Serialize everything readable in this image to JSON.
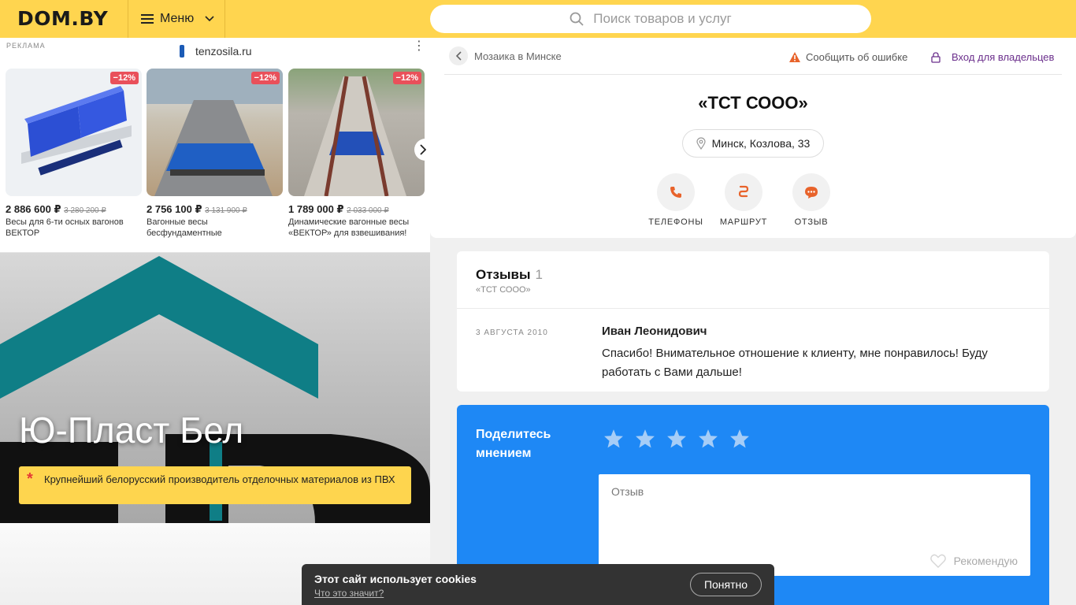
{
  "header": {
    "logo": "DOM.BY",
    "menu_label": "Меню",
    "search_placeholder": "Поиск товаров и услуг"
  },
  "ad": {
    "label": "РЕКЛАМА",
    "domain": "tenzosila.ru",
    "cards": [
      {
        "discount": "−12%",
        "price": "2 886 600 ₽",
        "old_price": "3 280 200 ₽",
        "title": "Весы для 6-ти осных вагонов ВЕКТОР"
      },
      {
        "discount": "−12%",
        "price": "2 756 100 ₽",
        "old_price": "3 131 900 ₽",
        "title": "Вагонные весы бесфундаментные"
      },
      {
        "discount": "−12%",
        "price": "1 789 000 ₽",
        "old_price": "2 033 000 ₽",
        "title": "Динамические вагонные весы «ВЕКТОР» для взвешивания!"
      }
    ]
  },
  "banner": {
    "title": "Ю-Пласт Бел",
    "tagline": "Крупнейший белорусский производитель отделочных материалов из ПВХ"
  },
  "company": {
    "breadcrumb": "Мозаика в Минске",
    "report_label": "Сообщить об ошибке",
    "owners_label": "Вход для владельцев",
    "name": "«ТСТ СООО»",
    "address": "Минск, Козлова, 33",
    "actions": {
      "phones": "ТЕЛЕФОНЫ",
      "route": "МАРШРУТ",
      "review": "ОТЗЫВ"
    }
  },
  "reviews": {
    "title": "Отзывы",
    "count": "1",
    "subtitle": "«ТСТ СООО»",
    "items": [
      {
        "date": "3 АВГУСТА 2010",
        "author": "Иван Леонидович",
        "text": "Спасибо! Внимательное отношение к клиенту, мне понравилось! Буду работать с Вами дальше!"
      }
    ]
  },
  "share": {
    "title": "Поделитесь мнением",
    "review_placeholder": "Отзыв",
    "recommend_label": "Рекомендую",
    "rating": 0,
    "rating_max": 5
  },
  "cookie": {
    "title": "Этот сайт использует cookies",
    "link": "Что это значит?",
    "button": "Понятно"
  },
  "colors": {
    "header_bg": "#ffd54f",
    "accent_blue": "#1e88f5",
    "action_icon": "#e8632b",
    "owners_link": "#6b2f8c",
    "badge": "#e9505a"
  }
}
